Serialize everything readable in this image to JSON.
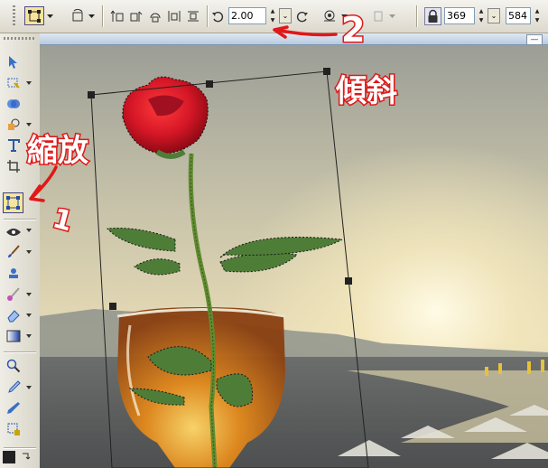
{
  "toolbar": {
    "angle_value": "2.00",
    "x_value": "369",
    "y_value": "584"
  },
  "annotations": {
    "skew_label": "傾斜",
    "scale_label": "縮放",
    "number_two": "2",
    "number_one": "1"
  },
  "colors": {
    "annotation_red": "#e01818",
    "selection_highlight": "#f8e49a",
    "rose_red": "#d41626"
  },
  "toolbox": {
    "icons": [
      "pick-tool-icon",
      "shape-edit-icon",
      "smart-fill-icon",
      "shape-icon",
      "text-icon",
      "crop-icon",
      "transform-icon",
      "eye-icon",
      "brush-icon",
      "stamp-icon",
      "effect-brush-icon",
      "eraser-icon",
      "gradient-icon",
      "zoom-icon",
      "eyedropper-icon",
      "pen-icon",
      "object-tool-icon"
    ]
  }
}
